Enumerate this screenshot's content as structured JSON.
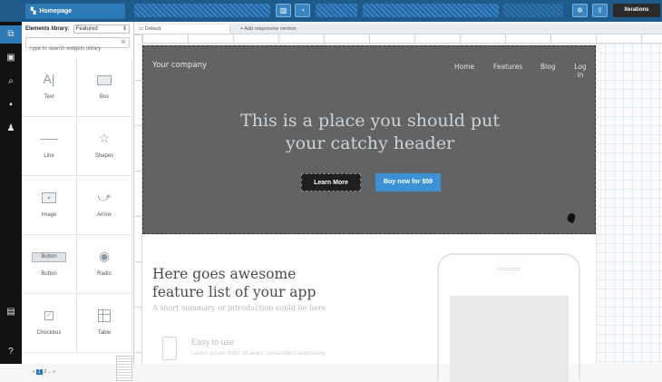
{
  "topbar": {
    "page_label": "Homepage",
    "iterations_label": "Iterations"
  },
  "widgets_panel": {
    "library_label": "Elements library:",
    "library_value": "Featured",
    "search_placeholder": "Type to search widgets library",
    "items": [
      {
        "label": "Text",
        "icon": "text-icon"
      },
      {
        "label": "Box",
        "icon": "box-icon"
      },
      {
        "label": "Line",
        "icon": "line-icon"
      },
      {
        "label": "Shapes",
        "icon": "star-icon"
      },
      {
        "label": "Image",
        "icon": "image-icon"
      },
      {
        "label": "Arrow",
        "icon": "arrow-icon"
      },
      {
        "label": "Button",
        "icon": "button-icon",
        "preview": "Button"
      },
      {
        "label": "Radio",
        "icon": "radio-icon"
      },
      {
        "label": "Checkbox",
        "icon": "checkbox-icon"
      },
      {
        "label": "Table",
        "icon": "table-icon"
      }
    ]
  },
  "canvas_tabs": {
    "active": "Default",
    "add": "+ Add responsive version"
  },
  "hero": {
    "brand": "Your company",
    "nav": [
      "Home",
      "Features",
      "Blog",
      "Log in"
    ],
    "headline_1": "This is a place you should put",
    "headline_2": "your catchy header",
    "btn_learn": "Learn More",
    "btn_buy": "Buy now for $59"
  },
  "content": {
    "heading_1": "Here goes awesome",
    "heading_2": "feature list of your app",
    "summary": "A short summary or introduction could be here",
    "feature_title": "Easy to use",
    "feature_text": "Lorem ipsum dolor sit amet, consectetur adipisicing"
  },
  "colors": {
    "topbar": "#1f5a8a",
    "accent": "#2d79b5",
    "hero_bg": "#636363",
    "buy_button": "#3d92d6"
  }
}
